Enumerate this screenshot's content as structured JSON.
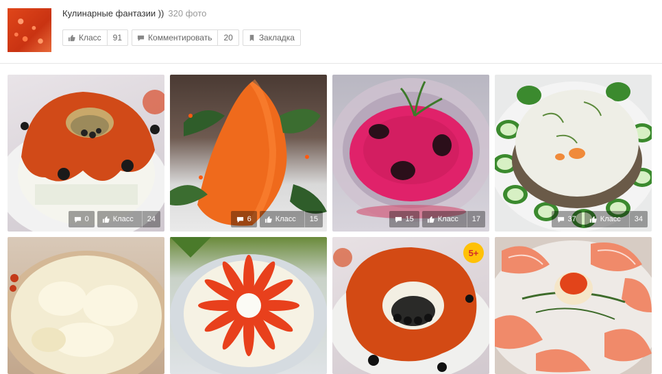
{
  "album": {
    "title": "Кулинарные фантазии ))",
    "photo_count": "320 фото"
  },
  "actions": {
    "like_label": "Класс",
    "like_count": "91",
    "comment_label": "Комментировать",
    "comment_count": "20",
    "bookmark_label": "Закладка"
  },
  "photos": [
    {
      "comments": "0",
      "like_label": "Класс",
      "likes": "24",
      "depicts": "caviar ring salad"
    },
    {
      "comments": "6",
      "like_label": "Класс",
      "likes": "15",
      "depicts": "caviar carrot salad"
    },
    {
      "comments": "15",
      "like_label": "Класс",
      "likes": "17",
      "depicts": "beet salad with prunes"
    },
    {
      "comments": "37",
      "like_label": "Класс",
      "likes": "34",
      "depicts": "aspic with cucumbers"
    },
    {
      "depicts": "cheese grated salad"
    },
    {
      "depicts": "tomato flower salad"
    },
    {
      "badge": "5+",
      "depicts": "caviar ring salad with olives"
    },
    {
      "depicts": "salmon platter"
    }
  ],
  "colors": {
    "badge_bg": "#ffc107",
    "badge_text": "#d12b2b",
    "overlay": "rgba(0,0,0,0.35)"
  }
}
